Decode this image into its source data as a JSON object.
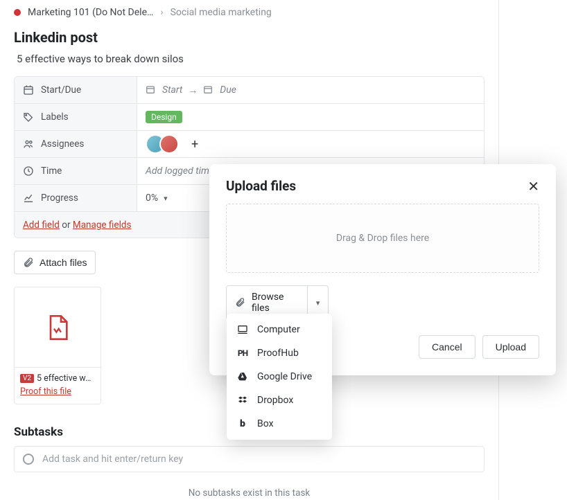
{
  "breadcrumb": {
    "project": "Marketing 101 (Do Not Dele…",
    "section": "Social media marketing"
  },
  "task": {
    "title": "Linkedin post",
    "subtitle": "5 effective ways to break down silos"
  },
  "fields": {
    "startdue_key": "Start/Due",
    "start_placeholder": "Start",
    "due_placeholder": "Due",
    "labels_key": "Labels",
    "labels": [
      "Design"
    ],
    "assignees_key": "Assignees",
    "time_key": "Time",
    "time_placeholder": "Add logged tim",
    "progress_key": "Progress",
    "progress_value": "0%",
    "footer_add": "Add field",
    "footer_or": " or ",
    "footer_manage": "Manage fields"
  },
  "attach": {
    "button": "Attach files",
    "file_version": "V2",
    "file_name": "5 effective w…",
    "proof_link": "Proof this file"
  },
  "subtasks": {
    "heading": "Subtasks",
    "placeholder": "Add task and hit enter/return key",
    "empty": "No subtasks exist in this task"
  },
  "modal": {
    "title": "Upload files",
    "dropzone": "Drag & Drop files here",
    "browse": "Browse files",
    "sources": {
      "computer": "Computer",
      "proofhub": "ProofHub",
      "gdrive": "Google Drive",
      "dropbox": "Dropbox",
      "box": "Box"
    },
    "cancel": "Cancel",
    "upload": "Upload"
  }
}
